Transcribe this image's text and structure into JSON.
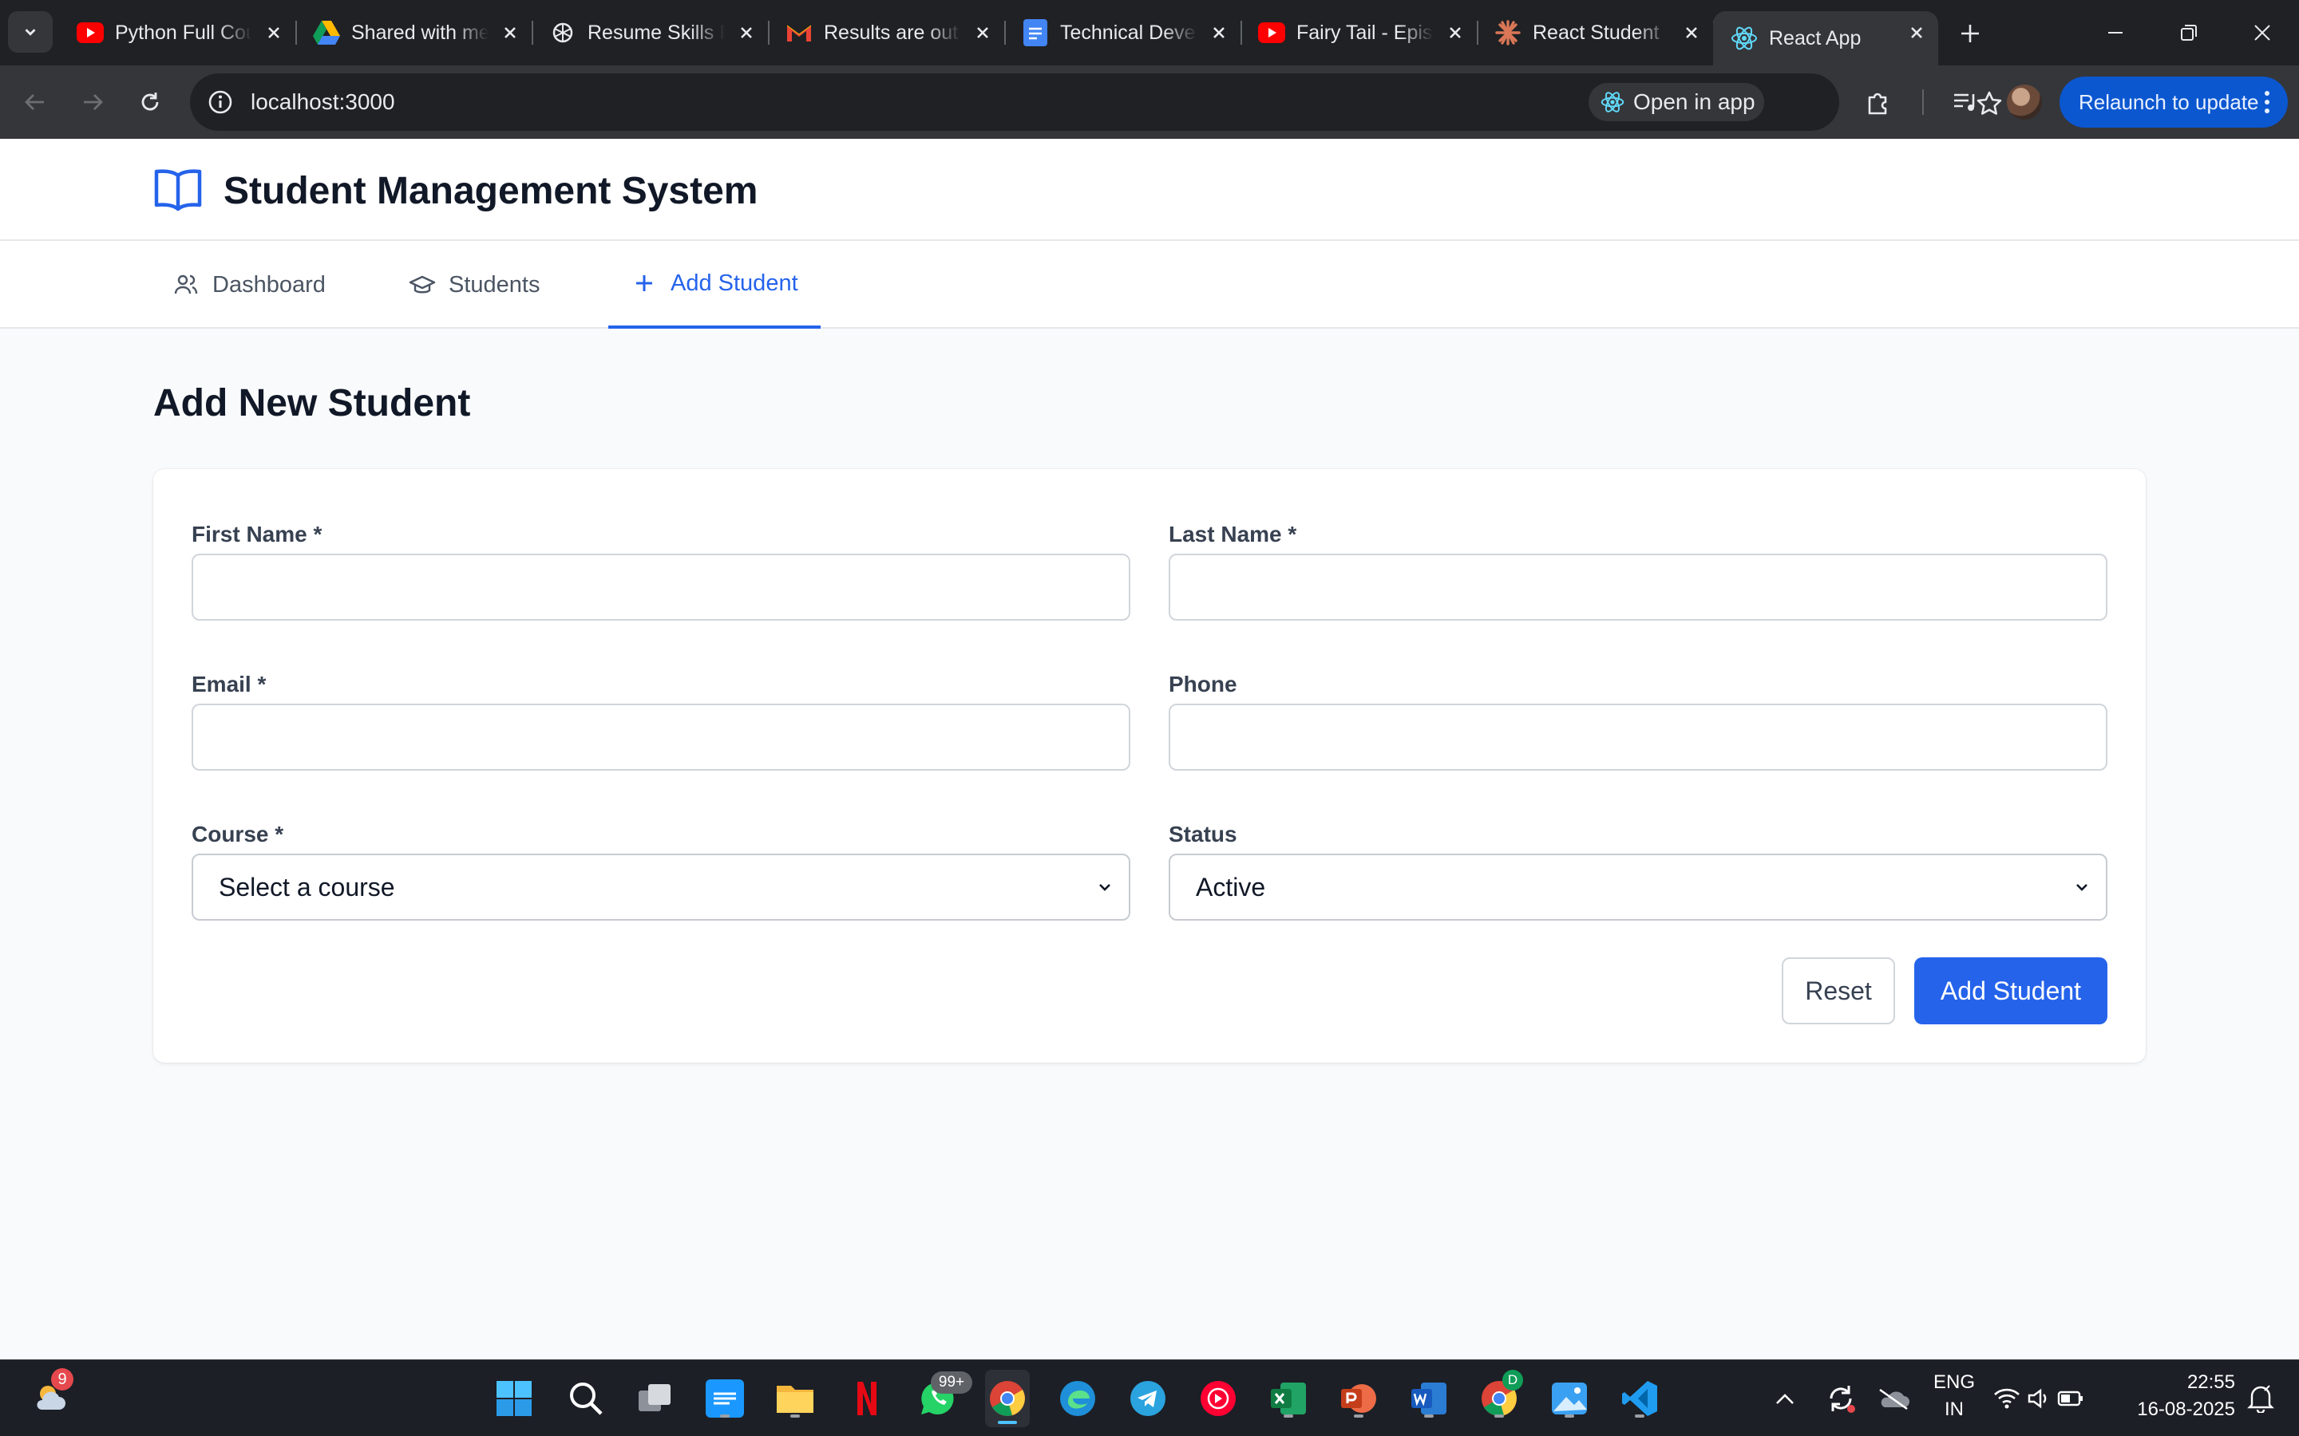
{
  "browser": {
    "tabs": [
      {
        "title": "Python Full Course",
        "icon": "youtube-icon"
      },
      {
        "title": "Shared with me",
        "icon": "google-drive-icon"
      },
      {
        "title": "Resume Skills Review",
        "icon": "chatgpt-icon"
      },
      {
        "title": "Results are out",
        "icon": "gmail-icon"
      },
      {
        "title": "Technical Development",
        "icon": "google-docs-icon"
      },
      {
        "title": "Fairy Tail - Episode",
        "icon": "youtube-icon"
      },
      {
        "title": "React Student",
        "icon": "claude-icon"
      },
      {
        "title": "React App",
        "icon": "react-icon",
        "active": true
      }
    ],
    "url": "localhost:3000",
    "open_in_app": "Open in app",
    "relaunch": "Relaunch to update"
  },
  "app": {
    "title": "Student Management System",
    "nav": [
      {
        "label": "Dashboard",
        "icon": "users-icon"
      },
      {
        "label": "Students",
        "icon": "graduation-cap-icon"
      },
      {
        "label": "Add Student",
        "icon": "plus-icon",
        "active": true
      }
    ],
    "page_title": "Add New Student",
    "form": {
      "first_name": {
        "label": "First Name *",
        "value": ""
      },
      "last_name": {
        "label": "Last Name *",
        "value": ""
      },
      "email": {
        "label": "Email *",
        "value": ""
      },
      "phone": {
        "label": "Phone",
        "value": ""
      },
      "course": {
        "label": "Course *",
        "selected": "Select a course"
      },
      "status": {
        "label": "Status",
        "selected": "Active"
      },
      "reset_label": "Reset",
      "submit_label": "Add Student"
    },
    "colors": {
      "accent": "#2563eb",
      "text": "#111827",
      "muted": "#4b5563",
      "background": "#f9fafb"
    }
  },
  "taskbar": {
    "weather_badge": "9",
    "whatsapp_badge": "99+",
    "chrome_profile_badge": "D",
    "language": "ENG",
    "region": "IN",
    "time": "22:55",
    "date": "16-08-2025"
  }
}
